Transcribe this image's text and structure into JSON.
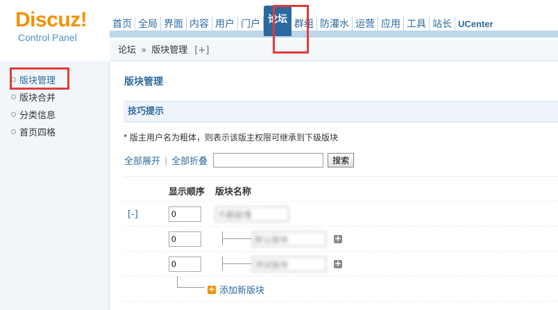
{
  "logo": {
    "main": "Discuz!",
    "sub": "Control Panel"
  },
  "nav": {
    "items": [
      "首页",
      "全局",
      "界面",
      "内容",
      "用户",
      "门户",
      "论坛",
      "群组",
      "防灌水",
      "运营",
      "应用",
      "工具",
      "站长",
      "UCenter"
    ],
    "active_index": 6
  },
  "breadcrumb": {
    "section": "论坛",
    "separator": "»",
    "page": "版块管理",
    "plus": "[+]"
  },
  "sidebar": {
    "items": [
      "版块管理",
      "版块合并",
      "分类信息",
      "首页四格"
    ],
    "active_index": 0
  },
  "main": {
    "title": "版块管理",
    "tips_title": "技巧提示",
    "tip": "版主用户名为粗体，则表示该版主权限可继承到下级版块",
    "expand_all": "全部展开",
    "divider": "|",
    "collapse_all": "全部折叠",
    "search_placeholder": "",
    "search_button": "搜索",
    "col_order": "显示顺序",
    "col_name": "版块名称",
    "toggle": "[-]",
    "rows": [
      {
        "order": "0",
        "name": "示範版塊"
      },
      {
        "order": "0",
        "name": "默认版块"
      },
      {
        "order": "0",
        "name": "测试版块"
      }
    ],
    "add_new": "添加新版块"
  },
  "colors": {
    "accent": "#2b6a9e",
    "logo": "#f39000",
    "annotation": "#e23a3a"
  }
}
